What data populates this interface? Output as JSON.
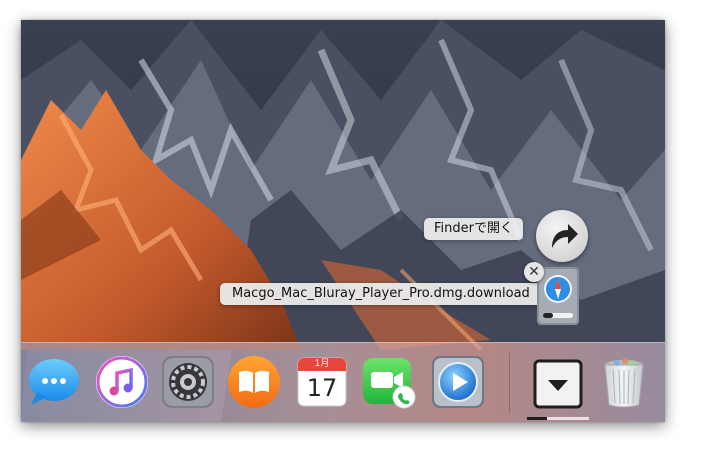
{
  "tooltips": {
    "finder": "Finderで開く",
    "file": "Macgo_Mac_Bluray_Player_Pro.dmg.download"
  },
  "icons": {
    "open_in_finder": "curved-arrow-icon",
    "downloading_file": "safari-download-icon",
    "remove": "close-icon"
  },
  "calendar": {
    "month": "1月",
    "day": "17"
  },
  "dock": {
    "items": [
      "Messages",
      "iTunes",
      "System Preferences",
      "iBooks",
      "Calendar",
      "FaceTime",
      "Macgo Blu-ray Player",
      "Downloads",
      "Trash"
    ]
  },
  "download": {
    "progress": 0.32
  },
  "colors": {
    "accent": "#1d8cf0",
    "progress_track": "#ffffff",
    "progress_fill": "#202020"
  }
}
